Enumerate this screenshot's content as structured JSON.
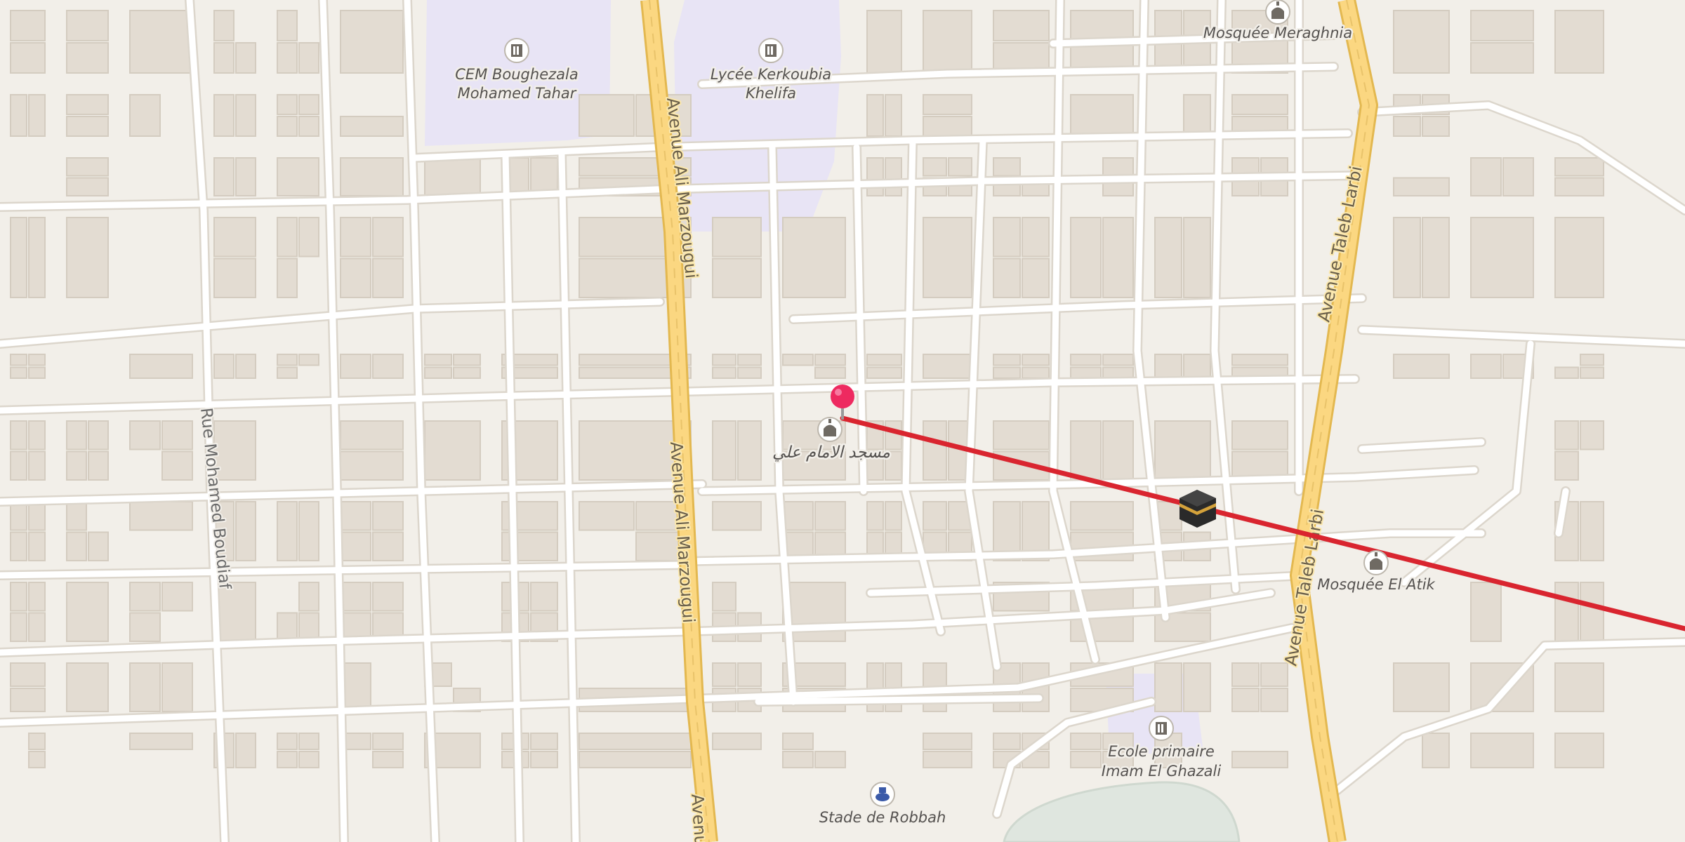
{
  "map": {
    "background_color": "#f2efe9",
    "colors": {
      "school_area": "#e8e4f5",
      "building": "#e3dcd2",
      "building_edge": "#d4ccc0",
      "minor_road": "#ffffff",
      "minor_road_casing": "#dcd6cc",
      "major_road": "#fbd781",
      "major_road_casing": "#e3b850",
      "qibla_line": "#d9252f",
      "pin": "#ee2a60",
      "green_area": "#dfe6df",
      "kaaba": "#2a2a2a",
      "kaaba_band": "#d4a23b"
    },
    "pois": [
      {
        "id": "cem",
        "name": "CEM Boughezala",
        "name2": "Mohamed Tahar",
        "icon": "school-icon"
      },
      {
        "id": "lycee",
        "name": "Lycée Kerkoubia",
        "name2": "Khelifa",
        "icon": "school-icon"
      },
      {
        "id": "meraghnia",
        "name": "Mosquée Meraghnia",
        "icon": "mosque-icon"
      },
      {
        "id": "imam-ali",
        "name": "مسجد الامام علي",
        "icon": "mosque-icon"
      },
      {
        "id": "el-atik",
        "name": "Mosquée El Atik",
        "icon": "mosque-icon"
      },
      {
        "id": "ghazali",
        "name": "Ecole primaire",
        "name2": "Imam El Ghazali",
        "icon": "school-icon"
      },
      {
        "id": "stade",
        "name": "Stade de Robbah",
        "icon": "stadium-icon"
      }
    ],
    "streets": {
      "ali_marzougui": "Avenue Ali Marzougui",
      "ali_marzougui_short": "Avenue",
      "taleb_larbi": "Avenue Taleb Larbi",
      "mohamed_boudiaf": "Rue Mohamed Boudiaf"
    },
    "markers": {
      "location_pin": "location-pin-icon",
      "kaaba": "kaaba-icon",
      "qibla_line": "qibla-direction-line"
    }
  }
}
